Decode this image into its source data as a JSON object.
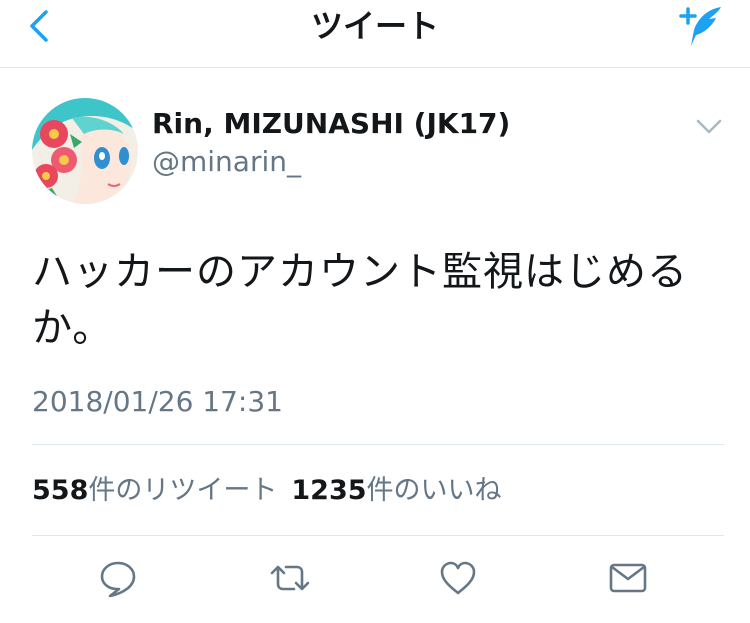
{
  "header": {
    "title": "ツイート",
    "back_icon": "chevron-left-icon",
    "compose_icon": "compose-tweet-icon"
  },
  "tweet": {
    "author_name": "Rin, MIZUNASHI (JK17)",
    "author_handle": "@minarin_",
    "text": "ハッカーのアカウント監視はじめるか。",
    "timestamp": "2018/01/26 17:31"
  },
  "stats": {
    "retweet_count": "558",
    "retweet_label": "件のリツイート",
    "like_count": "1235",
    "like_label": "件のいいね"
  },
  "actions": {
    "reply_icon": "reply-icon",
    "retweet_icon": "retweet-icon",
    "like_icon": "heart-icon",
    "dm_icon": "envelope-icon"
  },
  "colors": {
    "accent": "#1da1f2",
    "text": "#14171a",
    "secondary": "#657786",
    "divider": "#e1e8ed",
    "icon": "#657786"
  }
}
